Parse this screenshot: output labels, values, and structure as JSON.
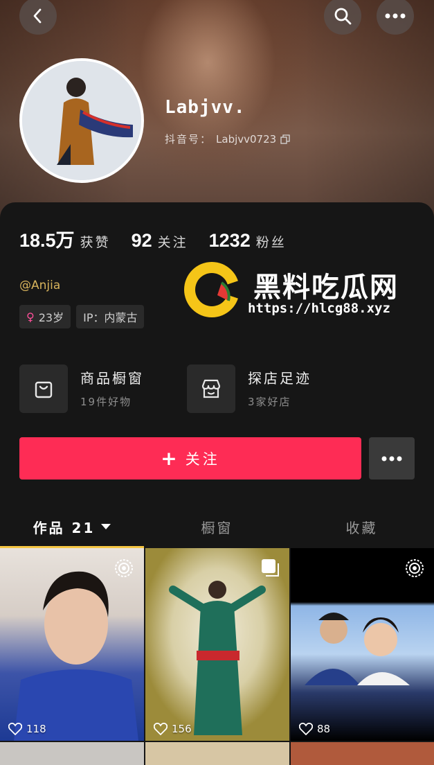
{
  "header": {
    "back_icon": "chevron-left-icon",
    "search_icon": "search-icon",
    "more_icon": "more-dots-icon"
  },
  "profile": {
    "nickname": "Labjvv.",
    "douyin_id_label": "抖音号：",
    "douyin_id": "Labjvv0723",
    "handle": "@Anjia"
  },
  "stats": [
    {
      "value": "18.5万",
      "label": "获赞"
    },
    {
      "value": "92",
      "label": "关注"
    },
    {
      "value": "1232",
      "label": "粉丝"
    }
  ],
  "tags": {
    "age": "23岁",
    "ip": "IP：内蒙古"
  },
  "shop": [
    {
      "title": "商品橱窗",
      "subtitle": "19件好物",
      "icon": "shopping-bag-icon"
    },
    {
      "title": "探店足迹",
      "subtitle": "3家好店",
      "icon": "store-icon"
    }
  ],
  "actions": {
    "follow_label": "关注"
  },
  "tabs": [
    {
      "label": "作品 21"
    },
    {
      "label": "橱窗"
    },
    {
      "label": "收藏"
    }
  ],
  "videos": [
    {
      "likes": "118"
    },
    {
      "likes": "156"
    },
    {
      "likes": "88"
    }
  ],
  "watermark": {
    "title": "黑料吃瓜网",
    "url": "https://hlcg88.xyz"
  },
  "colors": {
    "accent_red": "#fe2c55",
    "tab_underline": "#f5c542",
    "handle_gold": "#d8b45c"
  }
}
